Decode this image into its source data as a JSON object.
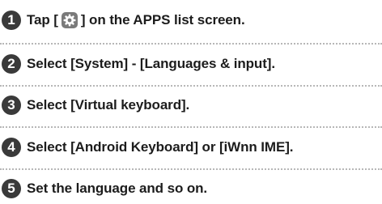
{
  "steps": [
    {
      "number": "1",
      "text_before_icon": "Tap [",
      "icon": "settings-gear-icon",
      "text_after_icon": "] on the APPS list screen."
    },
    {
      "number": "2",
      "text": "Select [System] - [Languages & input]."
    },
    {
      "number": "3",
      "text": "Select [Virtual keyboard]."
    },
    {
      "number": "4",
      "text": "Select [Android Keyboard] or [iWnn IME]."
    },
    {
      "number": "5",
      "text": "Set the language and so on."
    }
  ],
  "colors": {
    "badge": "#3a3a3a",
    "text": "#1c1c1c",
    "divider": "#b7b7b7",
    "icon": "#7a7a7a"
  }
}
